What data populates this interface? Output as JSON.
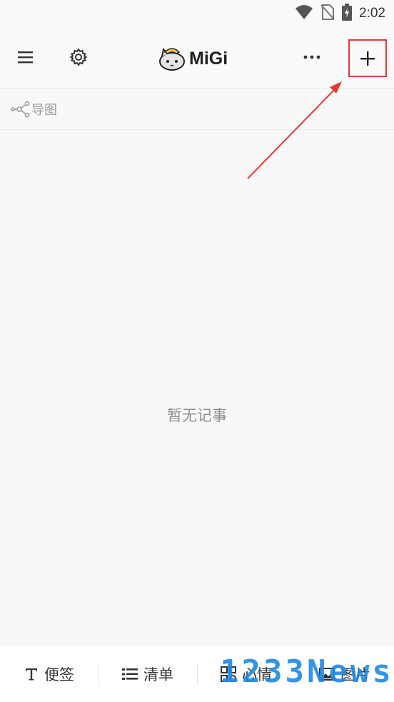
{
  "status_bar": {
    "time": "2:02"
  },
  "app_bar": {
    "logo_text": "MiGi"
  },
  "filter": {
    "label": "导图"
  },
  "empty_state": {
    "text": "暂无记事"
  },
  "bottom_bar": {
    "items": [
      {
        "label": "便签"
      },
      {
        "label": "清单"
      },
      {
        "label": "心情"
      },
      {
        "label": "图片"
      }
    ]
  },
  "watermark": {
    "text": "1233News"
  },
  "colors": {
    "annotation_red": "#e53935",
    "watermark_blue": "#1e88e5"
  }
}
